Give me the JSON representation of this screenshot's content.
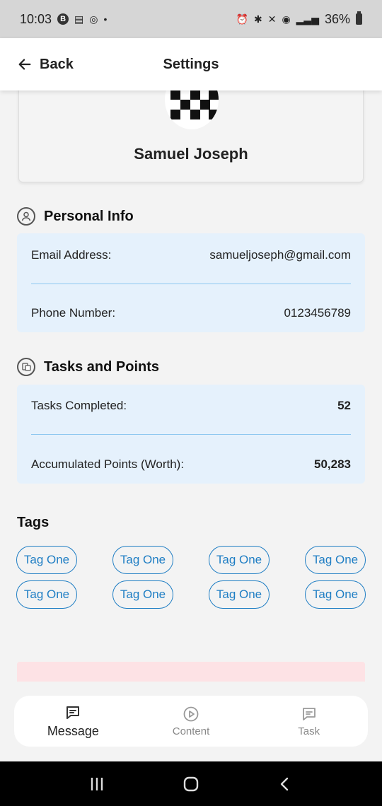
{
  "status_bar": {
    "time": "10:03",
    "battery": "36%"
  },
  "header": {
    "back_label": "Back",
    "title": "Settings"
  },
  "profile": {
    "name": "Samuel Joseph"
  },
  "personal_info": {
    "title": "Personal Info",
    "rows": [
      {
        "label": "Email Address:",
        "value": "samueljoseph@gmail.com"
      },
      {
        "label": "Phone Number:",
        "value": "0123456789"
      }
    ]
  },
  "tasks_points": {
    "title": "Tasks and Points",
    "rows": [
      {
        "label": "Tasks Completed:",
        "value": "52"
      },
      {
        "label": "Accumulated Points (Worth):",
        "value": "50,283"
      }
    ]
  },
  "tags": {
    "title": "Tags",
    "items": [
      "Tag One",
      "Tag One",
      "Tag One",
      "Tag One",
      "Tag One",
      "Tag One",
      "Tag One",
      "Tag One"
    ]
  },
  "bottom_nav": {
    "items": [
      {
        "label": "Message",
        "icon": "message-icon"
      },
      {
        "label": "Content",
        "icon": "play-icon"
      },
      {
        "label": "Task",
        "icon": "task-icon"
      }
    ]
  },
  "colors": {
    "accent": "#1f7ec4",
    "card_bg": "#e5f1fc",
    "danger": "#d32f2f"
  }
}
